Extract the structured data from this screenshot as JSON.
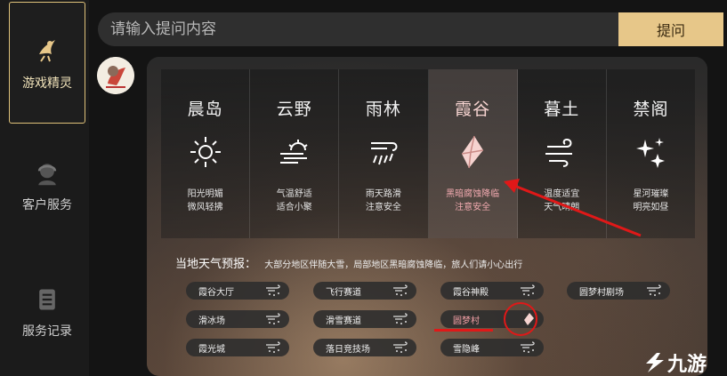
{
  "sidebar": {
    "items": [
      {
        "label": "游戏精灵",
        "icon": "fairy-icon",
        "active": true
      },
      {
        "label": "客户服务",
        "icon": "headset-icon",
        "active": false
      },
      {
        "label": "服务记录",
        "icon": "list-icon",
        "active": false
      }
    ]
  },
  "search": {
    "placeholder": "请输入提问内容",
    "button_label": "提问"
  },
  "regions": [
    {
      "name": "晨岛",
      "icon": "sun-icon",
      "desc1": "阳光明媚",
      "desc2": "微风轻拂"
    },
    {
      "name": "云野",
      "icon": "sun-cloud-icon",
      "desc1": "气温舒适",
      "desc2": "适合小聚"
    },
    {
      "name": "雨林",
      "icon": "rain-icon",
      "desc1": "雨天路滑",
      "desc2": "注意安全"
    },
    {
      "name": "霞谷",
      "icon": "dark-crystal-icon",
      "desc1": "黑暗腐蚀降临",
      "desc2": "注意安全"
    },
    {
      "name": "暮土",
      "icon": "wind-icon",
      "desc1": "温度适宜",
      "desc2": "天气晴朗"
    },
    {
      "name": "禁阁",
      "icon": "stars-icon",
      "desc1": "星河璀璨",
      "desc2": "明亮如昼"
    }
  ],
  "selected_region": "霞谷",
  "forecast": {
    "heading": "当地天气预报：",
    "text": "大部分地区伴随大雪，局部地区黑暗腐蚀降临，旅人们请小心出行"
  },
  "places": [
    {
      "name": "霞谷大厅",
      "icon": "snow-icon"
    },
    {
      "name": "飞行赛道",
      "icon": "snow-icon"
    },
    {
      "name": "霞谷神殿",
      "icon": "snow-icon"
    },
    {
      "name": "圆梦村剧场",
      "icon": "snow-icon"
    },
    {
      "name": "滑冰场",
      "icon": "snow-icon"
    },
    {
      "name": "滑雪赛道",
      "icon": "snow-icon"
    },
    {
      "name": "圆梦村",
      "icon": "dark-crystal-icon",
      "highlight": true
    },
    {
      "name": "霞光城",
      "icon": "snow-icon"
    },
    {
      "name": "落日竞技场",
      "icon": "snow-icon"
    },
    {
      "name": "雪隐峰",
      "icon": "snow-icon"
    }
  ],
  "watermark": "九游",
  "colors": {
    "accent_gold": "#e7c789",
    "alert_pink": "#f3a0a6",
    "annotation_red": "#e01818"
  }
}
